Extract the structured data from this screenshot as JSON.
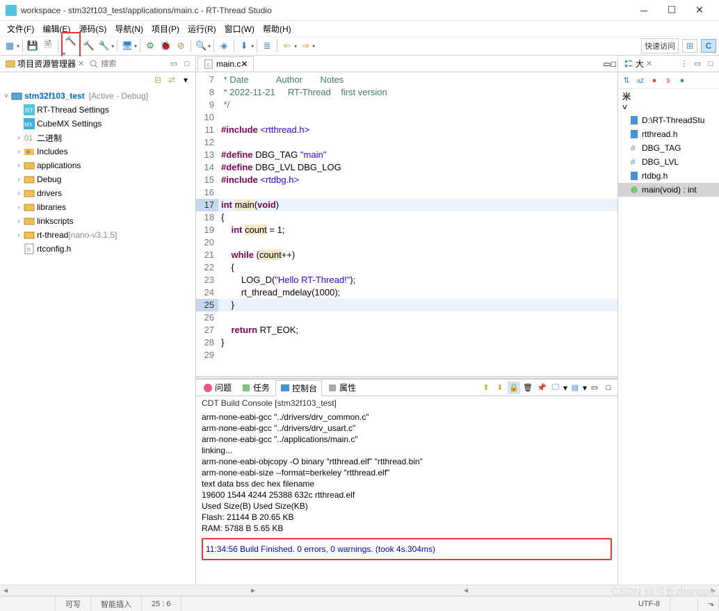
{
  "window": {
    "title": "workspace - stm32f103_test/applications/main.c - RT-Thread Studio"
  },
  "menu": {
    "file": "文件(F)",
    "edit": "编辑(E)",
    "source": "源码(S)",
    "nav": "导航(N)",
    "project": "项目(P)",
    "run": "运行(R)",
    "window": "窗口(W)",
    "help": "帮助(H)"
  },
  "quickaccess": "快速访问",
  "projectExplorer": {
    "title": "项目资源管理器",
    "searchPlaceholder": "搜索",
    "project": {
      "name": "stm32f103_test",
      "config": "[Active - Debug]"
    },
    "items": [
      {
        "label": "RT-Thread Settings",
        "icon": "rt"
      },
      {
        "label": "CubeMX Settings",
        "icon": "mx"
      },
      {
        "label": "二进制",
        "icon": "bin",
        "expand": true
      },
      {
        "label": "Includes",
        "icon": "inc",
        "expand": true
      },
      {
        "label": "applications",
        "icon": "folder",
        "expand": true
      },
      {
        "label": "Debug",
        "icon": "folder",
        "expand": true
      },
      {
        "label": "drivers",
        "icon": "folder",
        "expand": true
      },
      {
        "label": "libraries",
        "icon": "folder",
        "expand": true
      },
      {
        "label": "linkscripts",
        "icon": "folder",
        "expand": true
      },
      {
        "label": "rt-thread",
        "icon": "folder",
        "expand": true,
        "suffix": "[nano-v3.1.5]"
      },
      {
        "label": "rtconfig.h",
        "icon": "hfile"
      }
    ]
  },
  "editor": {
    "activeTab": "main.c",
    "startLine": 7,
    "lines": [
      {
        "n": 7,
        "html": "<span class='cm'> * Date           Author       Notes</span>"
      },
      {
        "n": 8,
        "html": "<span class='cm'> * 2022-11-21     RT-Thread    first version</span>"
      },
      {
        "n": 9,
        "html": "<span class='cm'> */</span>"
      },
      {
        "n": 10,
        "html": ""
      },
      {
        "n": 11,
        "html": "<span class='pp'>#include</span> <span class='inc'>&lt;rtthread.h&gt;</span>"
      },
      {
        "n": 12,
        "html": ""
      },
      {
        "n": 13,
        "html": "<span class='pp'>#define</span> DBG_TAG <span class='str'>\"main\"</span>"
      },
      {
        "n": 14,
        "html": "<span class='pp'>#define</span> DBG_LVL DBG_LOG"
      },
      {
        "n": 15,
        "html": "<span class='pp'>#include</span> <span class='inc'>&lt;rtdbg.h&gt;</span>"
      },
      {
        "n": 16,
        "html": ""
      },
      {
        "n": 17,
        "html": "<span class='kw'>int</span> <span class='hl-var'>main</span>(<span class='kw'>void</span>)",
        "hl": true
      },
      {
        "n": 18,
        "html": "{"
      },
      {
        "n": 19,
        "html": "    <span class='kw'>int</span> <span class='hl-var'>count</span> = 1;"
      },
      {
        "n": 20,
        "html": ""
      },
      {
        "n": 21,
        "html": "    <span class='kw'>while</span> (<span class='hl-var'>count</span>++)"
      },
      {
        "n": 22,
        "html": "    {"
      },
      {
        "n": 23,
        "html": "        LOG_D(<span class='str'>\"Hello RT-Thread!\"</span>);"
      },
      {
        "n": 24,
        "html": "        rt_thread_mdelay(1000);"
      },
      {
        "n": 25,
        "html": "    }",
        "hl": true
      },
      {
        "n": 26,
        "html": ""
      },
      {
        "n": 27,
        "html": "    <span class='kw'>return</span> RT_EOK;"
      },
      {
        "n": 28,
        "html": "}"
      },
      {
        "n": 29,
        "html": ""
      }
    ]
  },
  "bottomTabs": {
    "problems": "问题",
    "tasks": "任务",
    "console": "控制台",
    "properties": "属性"
  },
  "console": {
    "title": "CDT Build Console [stm32f103_test]",
    "lines": [
      "arm-none-eabi-gcc \"../drivers/drv_common.c\"",
      "arm-none-eabi-gcc \"../drivers/drv_usart.c\"",
      "arm-none-eabi-gcc \"../applications/main.c\"",
      "linking...",
      "arm-none-eabi-objcopy -O binary \"rtthread.elf\"  \"rtthread.bin\"",
      "arm-none-eabi-size --format=berkeley \"rtthread.elf\"",
      "   text\t   data\t    bss\t    dec\t    hex\tfilename",
      "  19600\t   1544\t   4244\t  25388\t   632c\trtthread.elf",
      "",
      "             Used Size(B)           Used Size(KB)",
      "Flash:         21144 B               20.65 KB",
      "RAM:           5788 B                5.65 KB"
    ],
    "finish": "11:34:56 Build Finished. 0 errors, 0 warnings. (took 4s.304ms)"
  },
  "outline": {
    "title": "大",
    "items": [
      {
        "label": "D:\\RT-ThreadStu",
        "icon": "file-blue"
      },
      {
        "label": "rtthread.h",
        "icon": "file-blue"
      },
      {
        "label": "DBG_TAG",
        "icon": "hash"
      },
      {
        "label": "DBG_LVL",
        "icon": "hash"
      },
      {
        "label": "rtdbg.h",
        "icon": "file-blue"
      },
      {
        "label": "main(void) : int",
        "icon": "func",
        "sel": true
      }
    ]
  },
  "status": {
    "writable": "可写",
    "insert": "智能插入",
    "pos": "25 : 6",
    "encoding": "UTF-8",
    "watermark": "CSDN @弓长zhangpk"
  }
}
